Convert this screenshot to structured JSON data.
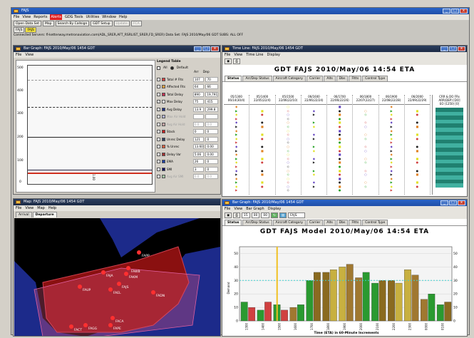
{
  "main": {
    "title": "FAJS",
    "menus": [
      "File",
      "View",
      "Reports",
      "Alerts",
      "GDG Tools",
      "Utilities",
      "Window",
      "Help"
    ],
    "toolbar": [
      "Open Data Set",
      "Map",
      "Search By Callsign",
      "GDT Setup",
      "Update",
      "FCA"
    ],
    "airport_tabs": [
      "FAJS",
      "FAJS"
    ],
    "status": "Connected Servers: fl-ketterway.metronaviation.com(ADL_SRER,AFT_RSRLIST_SRER,FD_SRER)   Data Set: FAJS 2010/May/06 GDT   SUBS: ALL OFF"
  },
  "bar_graph_small": {
    "title": "Bar Graph: FAJS 2010/May/06 1454 GDT",
    "menus": [
      "File",
      "View"
    ],
    "y_ticks": [
      "500",
      "400",
      "300",
      "200",
      "100",
      "0"
    ],
    "x_label": "1.00",
    "legend_title": "Legend Table",
    "legend_all": "All",
    "legend_default": "Default",
    "col_arr": "Arr",
    "col_dep": "Dep",
    "rows": [
      {
        "label": "Total # Flts",
        "color": "#d04040",
        "arr": "107",
        "dep": "70",
        "checked": false
      },
      {
        "label": "Affected Flts",
        "color": "#e8a040",
        "arr": "64",
        "dep": "66",
        "checked": false
      },
      {
        "label": "Total Delay",
        "color": "#c03050",
        "arr": "890",
        "dep": "19,791",
        "checked": false
      },
      {
        "label": "Max Delay",
        "color": "#ffffff",
        "arr": "75",
        "dep": "415",
        "checked": true
      },
      {
        "label": "Avg Delay",
        "color": "#203080",
        "arr": "13.9",
        "dep": "299.8",
        "checked": true
      },
      {
        "label": "Max Air Hold",
        "color": "#b0b0d0",
        "arr": "",
        "dep": "",
        "checked": false,
        "dim": true
      },
      {
        "label": "Avg Air Hold",
        "color": "#c0a0a0",
        "arr": "0.0",
        "dep": "0.0",
        "checked": false,
        "dim": true
      },
      {
        "label": "Stack",
        "color": "#c02020",
        "arr": "0",
        "dep": "0",
        "checked": false
      },
      {
        "label": "Unrec Delay",
        "color": "#304060",
        "arr": "121",
        "dep": "0",
        "checked": false
      },
      {
        "label": "% Unrec",
        "color": "#e06040",
        "arr": "13.60",
        "dep": "0.00",
        "checked": false
      },
      {
        "label": "Delay Var",
        "color": "#a03030",
        "arr": "5.06",
        "dep": "0.00",
        "checked": false
      },
      {
        "label": "EMA",
        "color": "#2040a0",
        "arr": "26",
        "dep": "0",
        "checked": false
      },
      {
        "label": "SMI",
        "color": "#101060",
        "arr": "3",
        "dep": "0",
        "checked": false
      },
      {
        "label": "Avg Air SMI",
        "color": "#a0c0a0",
        "arr": "0.0",
        "dep": "0.0",
        "checked": false,
        "dim": true
      }
    ]
  },
  "timeline": {
    "title": "Time Line: FAJS 2010/May/06 1454 GDT",
    "menus": [
      "File",
      "View",
      "Time Line",
      "Display"
    ],
    "header": "GDT    FAJS    2010/May/06    14:54    ETA",
    "tabs": [
      "Status",
      "Arr/Dep Status",
      "Aircraft Category",
      "Carrier",
      "Alts",
      "Dbs",
      "Fltts",
      "Control Type"
    ],
    "columns": [
      "05/1300\n06/14(30/4)",
      "05/1400\n22/05(22/4)",
      "05/1500\n22/06(22/10)",
      "06/1600\n22/06(22/24)",
      "06/1700\n22/06(22/26)",
      "06/1800\n22/07(22/27)",
      "06/1900\n22/08(22/28)",
      "06/2000\n22/09(22/29)"
    ],
    "side_header": "CRR & DO FRs\nARR(DEP) [DO]\nEO (1250) [0]"
  },
  "map": {
    "title": "Map: FAJS 2010/May/06 1454 GDT",
    "menus": [
      "File",
      "View",
      "Map",
      "Help"
    ],
    "tabs": [
      "Arrival",
      "Departure"
    ],
    "airports": [
      "FAPP",
      "FAJA",
      "FAKM",
      "FAWB",
      "FAJS",
      "FAUP",
      "FAEL",
      "FADN",
      "FACA",
      "FACT",
      "FAGG",
      "FAPE"
    ]
  },
  "bar_graph_large": {
    "title": "Bar Graph: FAJS 2010/May/06 1454 GDT",
    "menus": [
      "File",
      "View",
      "Bar Graph",
      "Display"
    ],
    "time_fields": [
      "15",
      "00",
      "00"
    ],
    "airport_field": "FAJS",
    "tabs": [
      "Status",
      "Arr/Dep Status",
      "Aircraft Category",
      "Carrier",
      "Alts",
      "Dbs",
      "Fltts",
      "Control Type"
    ],
    "header": "GDT    FAJS Model    2010/May/06    14:54    ETA",
    "y_ticks": [
      "50",
      "40",
      "30",
      "20",
      "10",
      "0"
    ],
    "y_ticks_right": [
      "50",
      "40",
      "30",
      "20",
      "10",
      "0"
    ],
    "x_ticks": [
      "1300",
      "1400",
      "1500",
      "1600",
      "1700",
      "1800",
      "1900",
      "2000",
      "2100",
      "2200",
      "2300",
      "0000",
      "0100"
    ],
    "ylabel": "Demand",
    "xlabel": "Time (ETA) in 60-Minute Increments"
  },
  "chart_data": {
    "type": "bar",
    "title": "GDT FAJS Model 2010/May/06 14:54 ETA",
    "xlabel": "Time (ETA) in 60-Minute Increments",
    "ylabel": "Demand",
    "ylim": [
      0,
      55
    ],
    "categories": [
      "1300",
      "1400",
      "1500",
      "1600",
      "1700",
      "1800",
      "1900",
      "2000",
      "2100",
      "2200",
      "2300",
      "0000",
      "0100"
    ],
    "series": [
      {
        "values": [
          14,
          8,
          12,
          10,
          30,
          36,
          40,
          32,
          28,
          30,
          38,
          16,
          12
        ]
      },
      {
        "values": [
          10,
          14,
          8,
          12,
          36,
          38,
          42,
          36,
          30,
          28,
          34,
          20,
          14
        ]
      }
    ],
    "capacity_line": 30
  },
  "colors": {
    "accent": "#2a64c8",
    "map_sea": "#203080",
    "map_land": "#8a1010",
    "status_red": "#e00000"
  }
}
